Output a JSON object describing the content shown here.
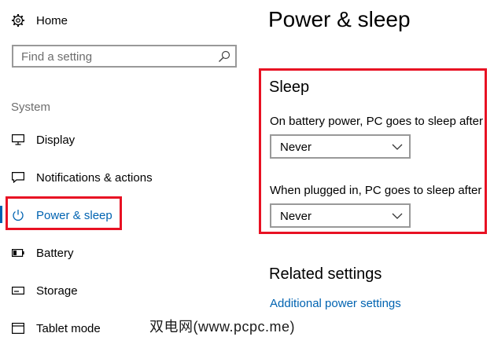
{
  "sidebar": {
    "home_label": "Home",
    "search_placeholder": "Find a setting",
    "section_title": "System",
    "items": [
      {
        "label": "Display",
        "icon": "monitor-icon"
      },
      {
        "label": "Notifications & actions",
        "icon": "notification-icon"
      },
      {
        "label": "Power & sleep",
        "icon": "power-icon",
        "selected": true
      },
      {
        "label": "Battery",
        "icon": "battery-icon"
      },
      {
        "label": "Storage",
        "icon": "storage-icon"
      },
      {
        "label": "Tablet mode",
        "icon": "tablet-mode-icon"
      }
    ]
  },
  "main": {
    "title": "Power & sleep",
    "sleep": {
      "heading": "Sleep",
      "battery_label": "On battery power, PC goes to sleep after",
      "battery_value": "Never",
      "plugged_label": "When plugged in, PC goes to sleep after",
      "plugged_value": "Never"
    },
    "related": {
      "heading": "Related settings",
      "link": "Additional power settings"
    }
  },
  "watermark": "双电网(www.pcpc.me)",
  "colors": {
    "accent": "#0063b1",
    "highlight_box": "#e81123"
  }
}
